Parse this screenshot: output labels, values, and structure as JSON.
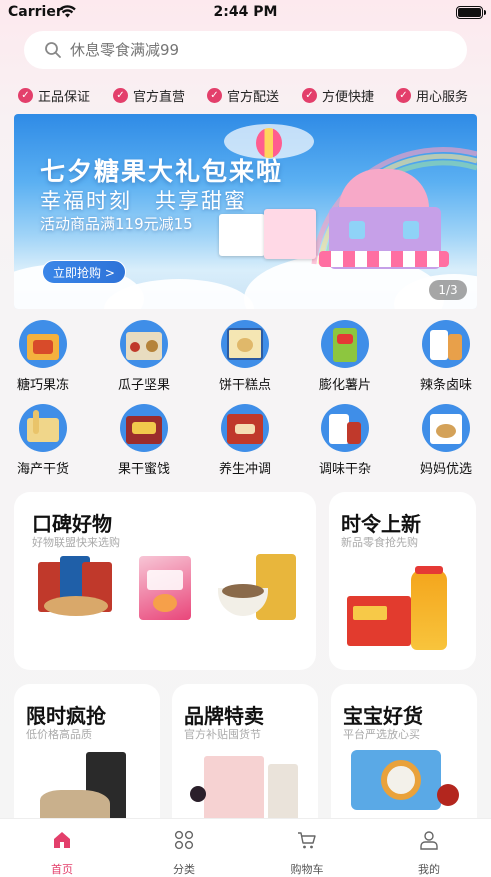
{
  "status_bar": {
    "carrier": "Carrier",
    "time": "2:44 PM"
  },
  "search": {
    "placeholder": "休息零食满减99"
  },
  "guarantees": [
    "正品保证",
    "官方直营",
    "官方配送",
    "方便快捷",
    "用心服务"
  ],
  "banner": {
    "title": "七夕糖果大礼包来啦",
    "subtitle": "幸福时刻　共享甜蜜",
    "promo": "活动商品满119元减15",
    "button": "立即抢购 >",
    "pager": "1/3"
  },
  "categories": [
    {
      "label": "糖巧果冻",
      "icon": "candy-icon"
    },
    {
      "label": "瓜子坚果",
      "icon": "nuts-icon"
    },
    {
      "label": "饼干糕点",
      "icon": "biscuit-icon"
    },
    {
      "label": "膨化薯片",
      "icon": "chips-icon"
    },
    {
      "label": "辣条卤味",
      "icon": "spicy-strip-icon"
    },
    {
      "label": "海产干货",
      "icon": "seafood-icon"
    },
    {
      "label": "果干蜜饯",
      "icon": "dried-fruit-icon"
    },
    {
      "label": "养生冲调",
      "icon": "health-drink-icon"
    },
    {
      "label": "调味干杂",
      "icon": "seasoning-icon"
    },
    {
      "label": "妈妈优选",
      "icon": "mom-choice-icon"
    }
  ],
  "cards": {
    "koubei": {
      "title": "口碑好物",
      "subtitle": "好物联盟快来选购"
    },
    "shiling": {
      "title": "时令上新",
      "subtitle": "新品零食抢先购"
    },
    "xianshi": {
      "title": "限时疯抢",
      "subtitle": "低价格高品质"
    },
    "pinpai": {
      "title": "品牌特卖",
      "subtitle": "官方补贴囤货节"
    },
    "baobao": {
      "title": "宝宝好货",
      "subtitle": "平台严选放心买"
    }
  },
  "tabs": [
    {
      "label": "首页",
      "icon": "home-icon"
    },
    {
      "label": "分类",
      "icon": "category-icon"
    },
    {
      "label": "购物车",
      "icon": "cart-icon"
    },
    {
      "label": "我的",
      "icon": "profile-icon"
    }
  ],
  "colors": {
    "accent": "#e33f6b",
    "banner_blue": "#2f8be6",
    "category_bg": "#3f8ee8"
  }
}
